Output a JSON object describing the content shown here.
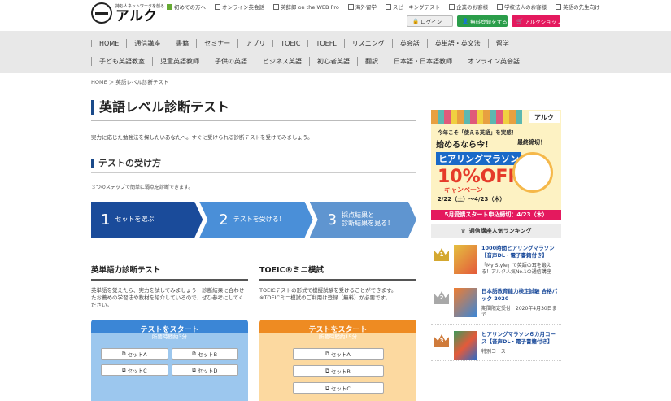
{
  "header": {
    "logo_tagline": "持ち人ネットワークを創る",
    "logo_name": "アルク",
    "top_links": [
      "初めての方へ",
      "オンライン英会話",
      "英辞郎 on the WEB Pro",
      "海外留学",
      "スピーキングテスト",
      "企業のお客様",
      "学校法人のお客様",
      "英語の先生向け"
    ],
    "login": "ログイン",
    "register": "無料登録をする",
    "shop": "アルクショップ"
  },
  "nav": {
    "row1": [
      "HOME",
      "通信講座",
      "書籍",
      "セミナー",
      "アプリ",
      "TOEIC",
      "TOEFL",
      "リスニング",
      "英会話",
      "英単語・英文法",
      "留学"
    ],
    "row2": [
      "子ども英語教室",
      "児童英語教師",
      "子供の英語",
      "ビジネス英語",
      "初心者英語",
      "翻訳",
      "日本語・日本語教師",
      "オンライン英会話"
    ]
  },
  "breadcrumb": "HOME ＞ 英語レベル診断テスト",
  "main": {
    "title": "英語レベル診断テスト",
    "intro": "実力に応じた勉強法を探したいあなたへ。すぐに受けられる診断テストを受けてみましょう。",
    "section_title": "テストの受け方",
    "section_sub": "３つのステップで簡単に弱点を診断できます。",
    "steps": [
      {
        "num": "1",
        "text": "セットを選ぶ"
      },
      {
        "num": "2",
        "text": "テストを受ける！"
      },
      {
        "num": "3",
        "text": "採点結果と\n診断結果を見る！"
      }
    ],
    "col1": {
      "title": "英単語力診断テスト",
      "desc": "英単語を覚えたら、実力を試してみましょう！診断結果に合わせたお薦めの学習法や教材を紹介しているので、ぜひ参考にしてください。",
      "start": "テストをスタート",
      "time": "所要時間約3分",
      "buttons": [
        "セットA",
        "セットB",
        "セットC",
        "セットD"
      ]
    },
    "col2": {
      "title": "TOEIC®ミニ模試",
      "desc": "TOEICテストの形式で模擬試験を受けることができます。\n※TOEICミニ模試のご利用は登録（無料）が必要です。",
      "start": "テストをスタート",
      "time": "所要時間約15分",
      "buttons": [
        "セットA",
        "セットB",
        "セットC"
      ]
    }
  },
  "sidebar": {
    "banner": {
      "logo": "アルク",
      "top": "今年こそ「使える英語」を実感！",
      "big": "始めるなら今！",
      "hm": "ヒアリングマラソン",
      "off": "10%OFF",
      "campaign": "キャンペーン",
      "date": "2/22（土）～4/23（木）",
      "last": "最終締切！",
      "bar": "5月受講スタート申込締切：4/23（木）"
    },
    "ranking_title": "通信講座人気ランキング",
    "ranking": [
      {
        "rank": "1",
        "title": "1000時間ヒアリングマラソン【音声DL・電子書籍付き】",
        "desc": "「My Style」で英語の耳を鍛える！アルク人気No.1の通信講座"
      },
      {
        "rank": "2",
        "title": "日本語教育能力検定試験 合格パック 2020",
        "desc": "期間限定受付：2020年4月30日まで"
      },
      {
        "rank": "3",
        "title": "ヒアリングマラソン６カ月コース【音声DL・電子書籍付き】",
        "desc": "特別コース"
      }
    ]
  }
}
